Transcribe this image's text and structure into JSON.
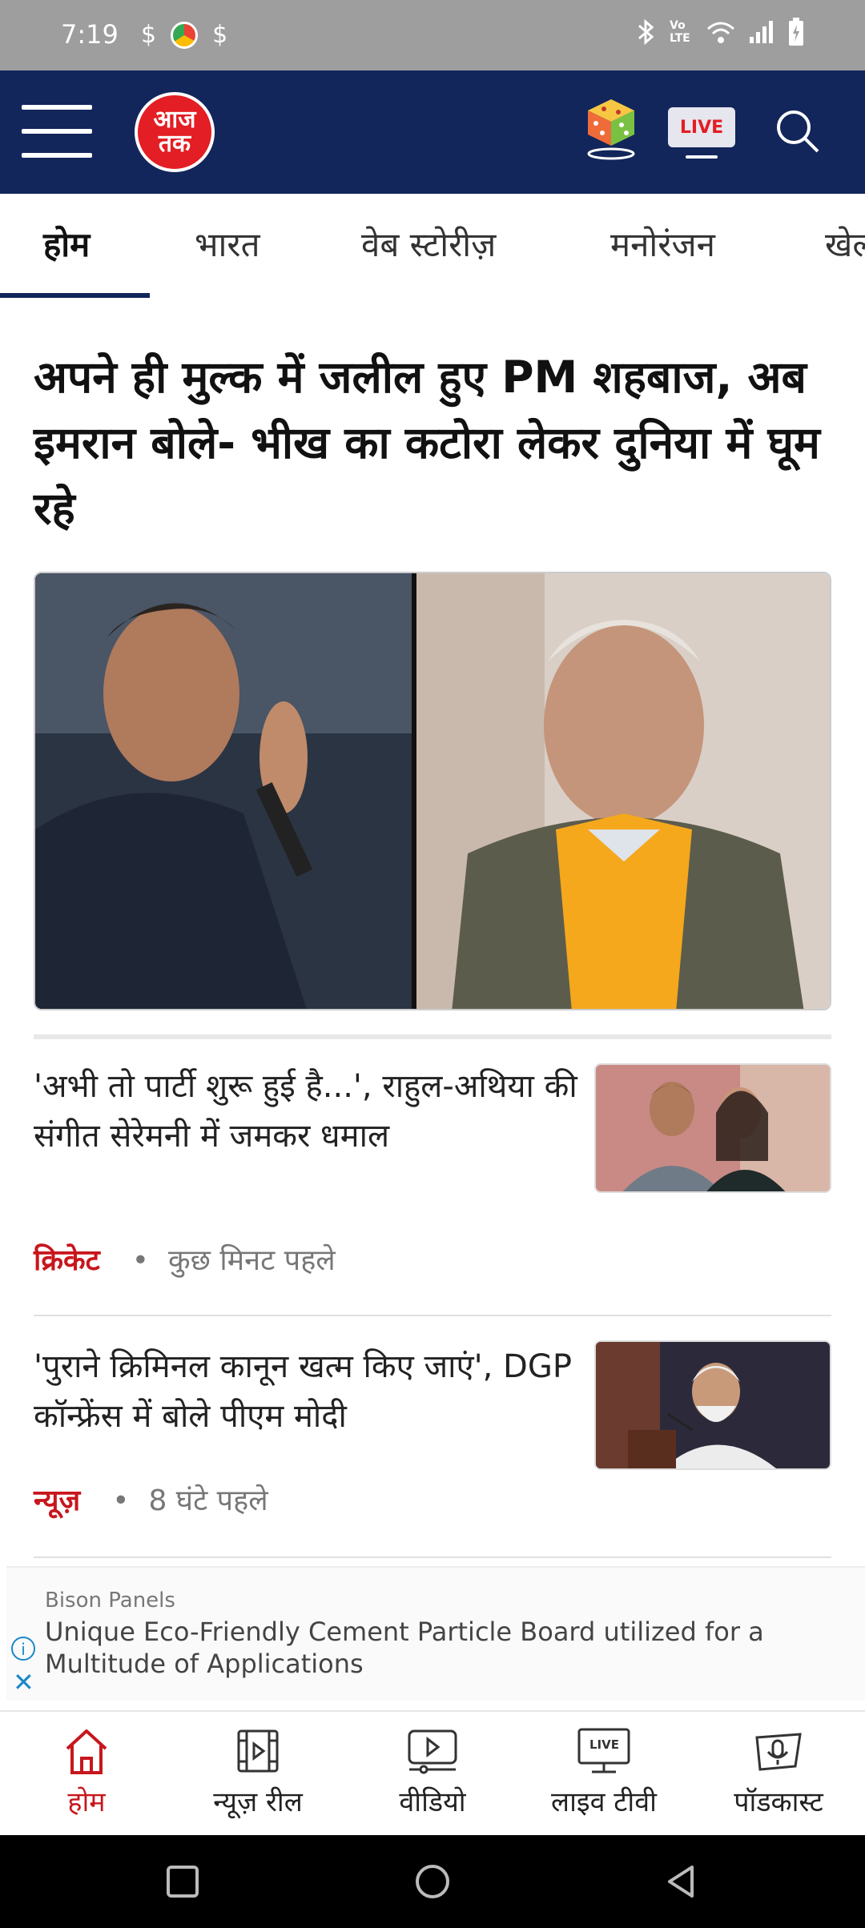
{
  "status_bar": {
    "time": "7:19",
    "left_icons": [
      "sim-icon",
      "chrome-icon",
      "sim-icon"
    ],
    "right_icons": [
      "bluetooth-icon",
      "volte-icon",
      "wifi-icon",
      "signal-icon",
      "battery-icon"
    ],
    "volte_label": "Vo LTE"
  },
  "header": {
    "logo_text_line1": "आज",
    "logo_text_line2": "तक",
    "live_label": "LIVE",
    "colors": {
      "header_bg": "#12265b",
      "brand_red": "#e31e24"
    }
  },
  "tabs": [
    {
      "label": "होम",
      "active": true
    },
    {
      "label": "भारत",
      "active": false
    },
    {
      "label": "वेब स्टोरीज़",
      "active": false
    },
    {
      "label": "मनोरंजन",
      "active": false
    },
    {
      "label": "खेल",
      "active": false
    }
  ],
  "top_story": {
    "headline": "अपने ही मुल्क में जलील हुए PM शहबाज, अब इमरान बोले- भीख का कटोरा लेकर दुनिया में घूम रहे"
  },
  "stories": [
    {
      "title": "'अभी तो पार्टी शुरू हुई है...', राहुल-अथिया की संगीत सेरेमनी में जमकर धमाल",
      "category": "क्रिकेट",
      "time": "कुछ मिनट पहले"
    },
    {
      "title": "'पुराने क्रिमिनल कानून खत्म किए जाएं', DGP कॉन्फ्रेंस में बोले पीएम मोदी",
      "category": "न्यूज़",
      "time": "8 घंटे पहले"
    }
  ],
  "ad": {
    "sponsor": "Bison Panels",
    "text": "Unique Eco-Friendly Cement Particle Board utilized for a Multitude of Applications"
  },
  "bottom_nav": [
    {
      "label": "होम",
      "icon": "home-icon",
      "active": true
    },
    {
      "label": "न्यूज़ रील",
      "icon": "film-reel-icon",
      "active": false
    },
    {
      "label": "वीडियो",
      "icon": "video-play-icon",
      "active": false
    },
    {
      "label": "लाइव टीवी",
      "icon": "live-tv-icon",
      "active": false
    },
    {
      "label": "पॉडकास्ट",
      "icon": "podcast-icon",
      "active": false
    }
  ],
  "bottom_nav_live_badge": "LIVE"
}
